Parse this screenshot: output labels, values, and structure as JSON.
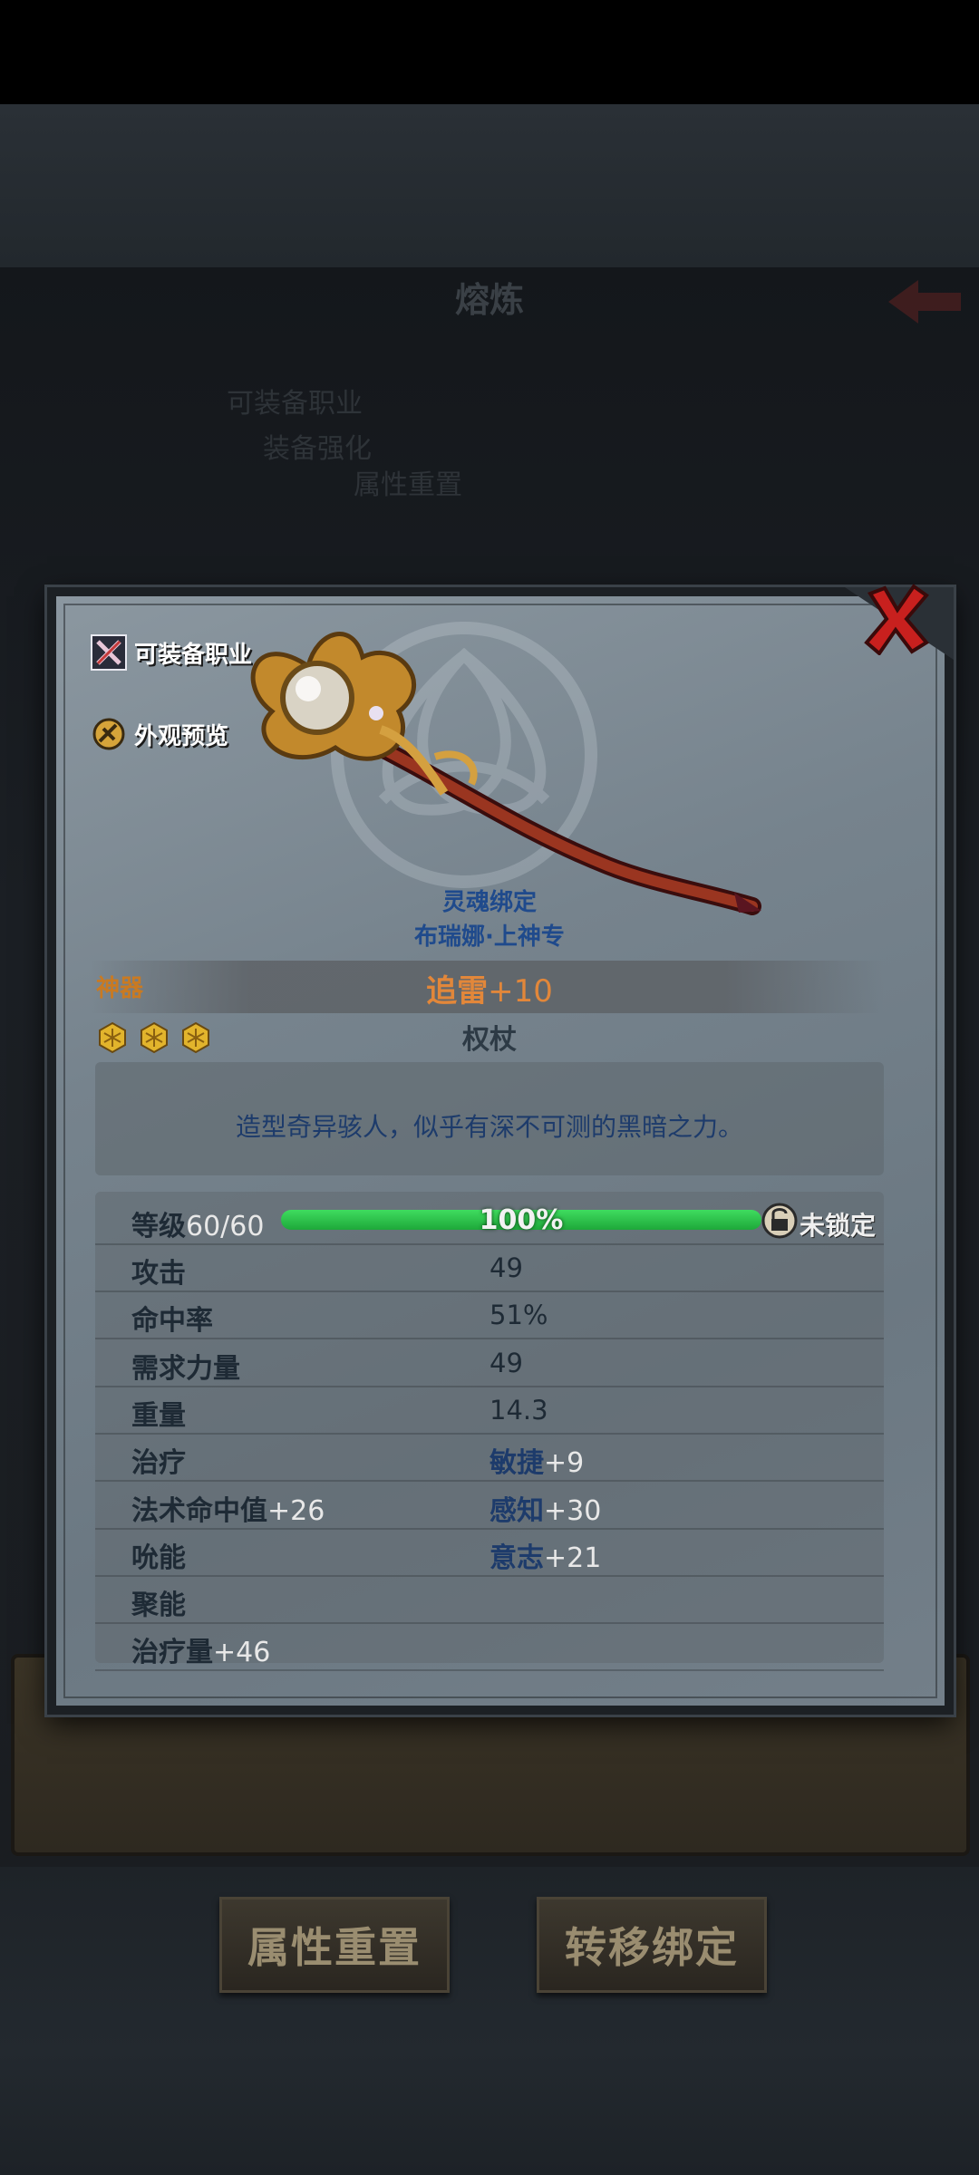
{
  "background": {
    "title": "熔炼",
    "line1": "可装备职业",
    "line2": "装备强化",
    "line3": "属性重置"
  },
  "side_buttons": {
    "equip_class": "可装备职业",
    "appearance_preview": "外观预览"
  },
  "item": {
    "bind_state": "灵魂绑定",
    "owner": "布瑞娜·上神专",
    "rarity": "神器",
    "name": "追雷",
    "enhance": "+10",
    "stars": 3,
    "type": "权杖",
    "description": "造型奇异骇人，似乎有深不可测的黑暗之力。"
  },
  "level": {
    "label": "等级",
    "value": "60/60",
    "progress_fraction": 1.0,
    "progress_text": "100%",
    "lock_text": "未锁定"
  },
  "stats": [
    {
      "left_label": "攻击",
      "left_value": "",
      "right_label": "",
      "right_value": "49"
    },
    {
      "left_label": "命中率",
      "left_value": "",
      "right_label": "",
      "right_value": "51%"
    },
    {
      "left_label": "需求力量",
      "left_value": "",
      "right_label": "",
      "right_value": "49"
    },
    {
      "left_label": "重量",
      "left_value": "",
      "right_label": "",
      "right_value": "14.3"
    },
    {
      "left_label": "治疗",
      "left_value": "",
      "right_label": "敏捷",
      "right_value": "+9"
    },
    {
      "left_label": "法术命中值",
      "left_value": "+26",
      "right_label": "感知",
      "right_value": "+30"
    },
    {
      "left_label": "吮能",
      "left_value": "",
      "right_label": "意志",
      "right_value": "+21"
    },
    {
      "left_label": "聚能",
      "left_value": "",
      "right_label": "",
      "right_value": ""
    },
    {
      "left_label": "治疗量",
      "left_value": "+46",
      "right_label": "",
      "right_value": ""
    }
  ],
  "bottom_buttons": {
    "reset": "属性重置",
    "transfer": "转移绑定"
  },
  "colors": {
    "rarity": "#c97a22",
    "item_name": "#e2873a",
    "bind_blue": "#1f4a8c",
    "progress_green": "#2ec24a",
    "close_red": "#c8201e"
  },
  "icons": {
    "close": "close-x-icon",
    "equip_class": "crossed-weapons-icon",
    "appearance": "appearance-icon",
    "star": "hexagon-star-icon",
    "lock": "padlock-icon",
    "back": "back-arrow-icon"
  }
}
